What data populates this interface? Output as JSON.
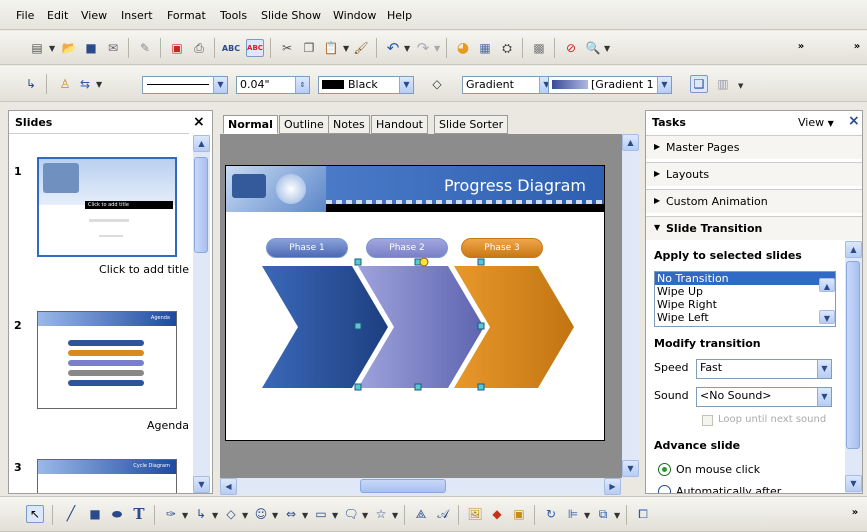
{
  "menu": [
    "File",
    "Edit",
    "View",
    "Insert",
    "Format",
    "Tools",
    "Slide Show",
    "Window",
    "Help"
  ],
  "line_toolbar": {
    "line_width": "0.04\"",
    "line_color": "Black",
    "fill_type": "Gradient",
    "fill_value": "[Gradient 1"
  },
  "slides_panel": {
    "title": "Slides",
    "close": "×",
    "slides": [
      {
        "number": "1",
        "caption": "Click to add title",
        "thumb_title": "Click to add title"
      },
      {
        "number": "2",
        "caption": "Agenda",
        "thumb_title": "Agenda"
      },
      {
        "number": "3",
        "caption": "",
        "thumb_title": "Cycle Diagram"
      }
    ]
  },
  "view_tabs": [
    "Normal",
    "Outline",
    "Notes",
    "Handout",
    "Slide Sorter"
  ],
  "slide": {
    "title": "Progress Diagram",
    "phases": [
      "Phase 1",
      "Phase 2",
      "Phase 3"
    ]
  },
  "tasks_panel": {
    "title": "Tasks",
    "view_label": "View",
    "close": "×",
    "sections": [
      "Master Pages",
      "Layouts",
      "Custom Animation",
      "Slide Transition"
    ],
    "apply_heading": "Apply to selected slides",
    "transitions": [
      "No Transition",
      "Wipe Up",
      "Wipe Right",
      "Wipe Left"
    ],
    "modify_heading": "Modify transition",
    "speed_label": "Speed",
    "speed_value": "Fast",
    "sound_label": "Sound",
    "sound_value": "<No Sound>",
    "loop_label": "Loop until next sound",
    "advance_heading": "Advance slide",
    "advance_options": [
      "On mouse click",
      "Automatically after"
    ]
  },
  "colors": {
    "slide_banner": "#2e5fb0",
    "phase1": "#2c5499",
    "phase2": "#7a80c8",
    "phase3": "#d98a1e",
    "selection": "#316ac5"
  }
}
